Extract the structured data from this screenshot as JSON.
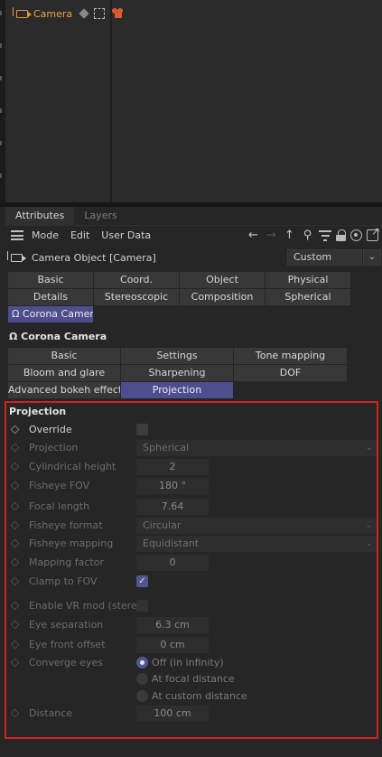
{
  "object_manager": {
    "object_name": "Camera",
    "icons": [
      "camera-icon",
      "layer-icon",
      "frame-icon",
      "corona-tag-icon"
    ]
  },
  "panel": {
    "tabs": [
      "Attributes",
      "Layers"
    ],
    "active_tab": "Attributes"
  },
  "menu": {
    "items": [
      "Mode",
      "Edit",
      "User Data"
    ],
    "tools": [
      "back-arrow-icon",
      "forward-arrow-icon",
      "up-arrow-icon",
      "search-icon",
      "filter-icon",
      "lock-icon",
      "target-icon",
      "new-window-icon"
    ]
  },
  "object_row": {
    "title": "Camera Object [Camera]",
    "mode_value": "Custom",
    "mode_caret": "⌄"
  },
  "object_tabs": {
    "row1": [
      "Basic",
      "Coord.",
      "Object",
      "Physical"
    ],
    "row2": [
      "Details",
      "Stereoscopic",
      "Composition",
      "Spherical"
    ],
    "row3": [
      "Ω Corona Camera"
    ]
  },
  "corona_section": {
    "title": "Ω Corona Camera",
    "row1": [
      "Basic",
      "Settings",
      "Tone mapping"
    ],
    "row2": [
      "Bloom and glare",
      "Sharpening",
      "DOF"
    ],
    "row3": [
      "Advanced bokeh effects",
      "Projection"
    ],
    "active": "Projection"
  },
  "projection": {
    "title": "Projection",
    "override_label": "Override",
    "override_checked": false,
    "projection_label": "Projection",
    "projection_value": "Spherical",
    "cyl_height_label": "Cylindrical height",
    "cyl_height_value": "2",
    "fisheye_fov_label": "Fisheye FOV",
    "fisheye_fov_value": "180 °",
    "focal_length_label": "Focal length",
    "focal_length_value": "7.64",
    "fisheye_format_label": "Fisheye format",
    "fisheye_format_value": "Circular",
    "fisheye_mapping_label": "Fisheye mapping",
    "fisheye_mapping_value": "Equidistant",
    "mapping_factor_label": "Mapping factor",
    "mapping_factor_value": "0",
    "clamp_fov_label": "Clamp to FOV",
    "clamp_fov_checked": true,
    "vr_label": "Enable VR mod (stereo)",
    "vr_checked": false,
    "eye_sep_label": "Eye separation",
    "eye_sep_value": "6.3 cm",
    "eye_front_label": "Eye front offset",
    "eye_front_value": "0 cm",
    "converge_label": "Converge eyes",
    "converge_options": [
      "Off (in infinity)",
      "At focal distance",
      "At custom distance"
    ],
    "converge_selected": "Off (in infinity)",
    "distance_label": "Distance",
    "distance_value": "100 cm",
    "check_glyph": "✓",
    "caret_glyph": "⌄"
  },
  "colors": {
    "accent_tab": "#4c4e8e",
    "highlight_border": "#d62020",
    "object_name": "#e8a349"
  }
}
